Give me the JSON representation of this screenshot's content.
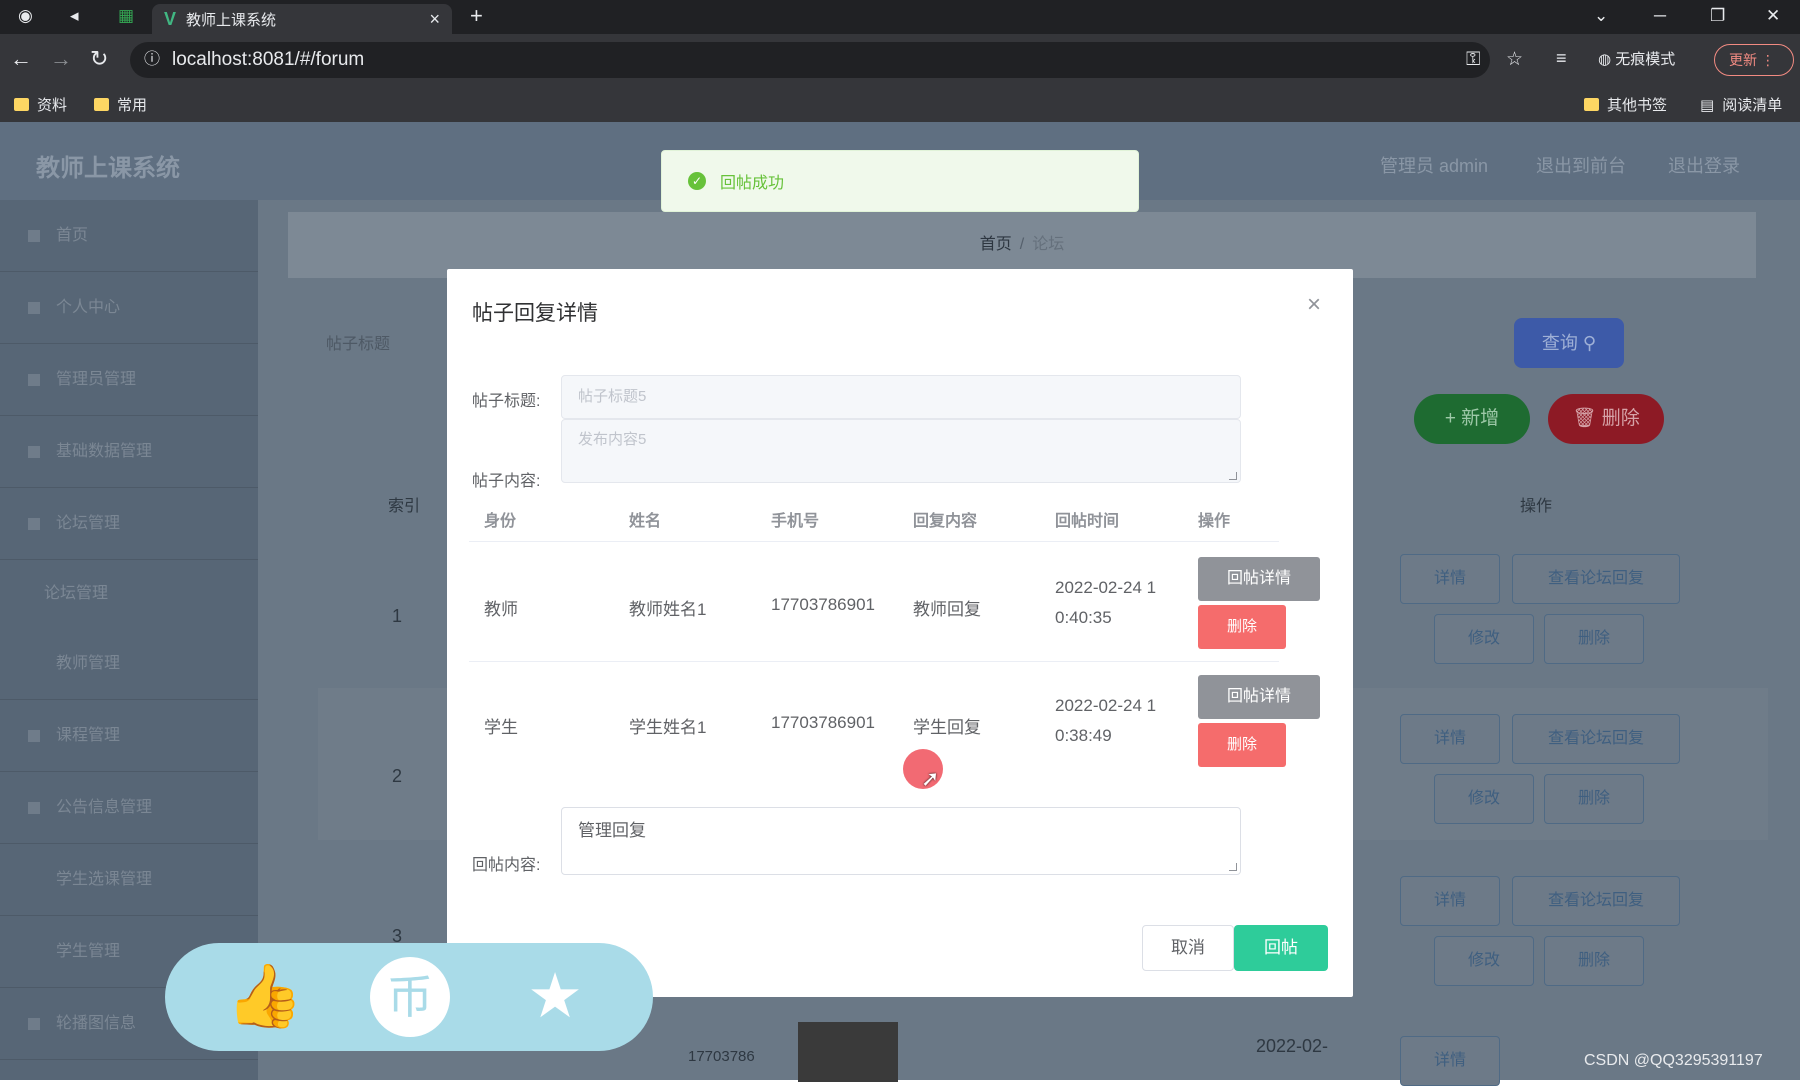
{
  "browser": {
    "tab_title": "教师上课系统",
    "tab_icon": "vue-icon",
    "url": "localhost:8081/#/forum",
    "incognito_label": "无痕模式",
    "update_label": "更新",
    "bookmarks": [
      "资料",
      "常用"
    ],
    "other_bookmarks": "其他书签",
    "reading_list": "阅读清单"
  },
  "app": {
    "title": "教师上课系统",
    "header_links": [
      "管理员 admin",
      "退出到前台",
      "退出登录"
    ]
  },
  "sidebar": {
    "items": [
      "首页",
      "个人中心",
      "管理员管理",
      "基础数据管理",
      "论坛管理",
      "论坛管理",
      "教师管理",
      "课程管理",
      "公告信息管理",
      "学生选课管理",
      "学生管理",
      "轮播图信息"
    ]
  },
  "breadcrumb": {
    "home": "首页",
    "separator": "/",
    "current": "论坛"
  },
  "search": {
    "label": "帖子标题",
    "query_button": "查询"
  },
  "actions": {
    "add": "+ 新增",
    "delete": "删除"
  },
  "table": {
    "index_header": "索引",
    "op_header": "操作",
    "rows": [
      "1",
      "2",
      "3"
    ],
    "buttons": {
      "detail": "详情",
      "view_reply": "查看论坛回复",
      "edit": "修改",
      "delete": "删除"
    },
    "partial_phone": "17703786",
    "partial_date": "2022-02-"
  },
  "toast": {
    "message": "回帖成功",
    "color": "#67c23a"
  },
  "dialog": {
    "title": "帖子回复详情",
    "post_title_label": "帖子标题:",
    "post_title_value": "帖子标题5",
    "post_content_label": "帖子内容:",
    "post_content_value": "发布内容5",
    "columns": [
      "身份",
      "姓名",
      "手机号",
      "回复内容",
      "回帖时间",
      "操作"
    ],
    "replies": [
      {
        "role": "教师",
        "name": "教师姓名1",
        "phone": "17703786901",
        "content": "教师回复",
        "time": "2022-02-24 10:40:35",
        "time_line1": "2022-02-24 1",
        "time_line2": "0:40:35"
      },
      {
        "role": "学生",
        "name": "学生姓名1",
        "phone": "17703786901",
        "content": "学生回复",
        "time": "2022-02-24 10:38:49",
        "time_line1": "2022-02-24 1",
        "time_line2": "0:38:49"
      }
    ],
    "reply_detail_button": "回帖详情",
    "reply_delete_button": "删除",
    "reply_label": "回帖内容:",
    "reply_value": "管理回复",
    "cancel_button": "取消",
    "submit_button": "回帖"
  },
  "overlay": {
    "watermark": "CSDN @QQ3295391197"
  }
}
